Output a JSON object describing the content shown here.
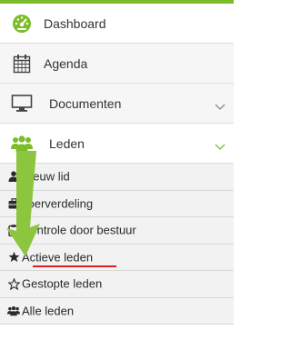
{
  "colors": {
    "accent": "#7cbd2a",
    "arrow": "#8cc63f",
    "underline": "#e02020",
    "chevron": "#8a8a8a",
    "icon_dark": "#2a2a2a"
  },
  "menu": {
    "items": [
      {
        "label": "Dashboard",
        "icon": "dashboard-gauge-icon"
      },
      {
        "label": "Agenda",
        "icon": "calendar-icon"
      },
      {
        "label": "Documenten",
        "icon": "monitor-icon",
        "chevron": "chevron-down-icon"
      },
      {
        "label": "Leden",
        "icon": "users-group-icon",
        "chevron": "chevron-down-icon",
        "expanded": true
      }
    ]
  },
  "submenu": {
    "items": [
      {
        "label": "Nieuw lid",
        "icon": "user-icon"
      },
      {
        "label": "Toerverdeling",
        "icon": "briefcase-icon"
      },
      {
        "label": "Controle door bestuur",
        "icon": "clipboard-icon"
      },
      {
        "label": "Actieve leden",
        "icon": "star-filled-icon",
        "highlighted": true
      },
      {
        "label": "Gestopte leden",
        "icon": "star-outline-icon"
      },
      {
        "label": "Alle leden",
        "icon": "users-group-icon"
      }
    ]
  }
}
